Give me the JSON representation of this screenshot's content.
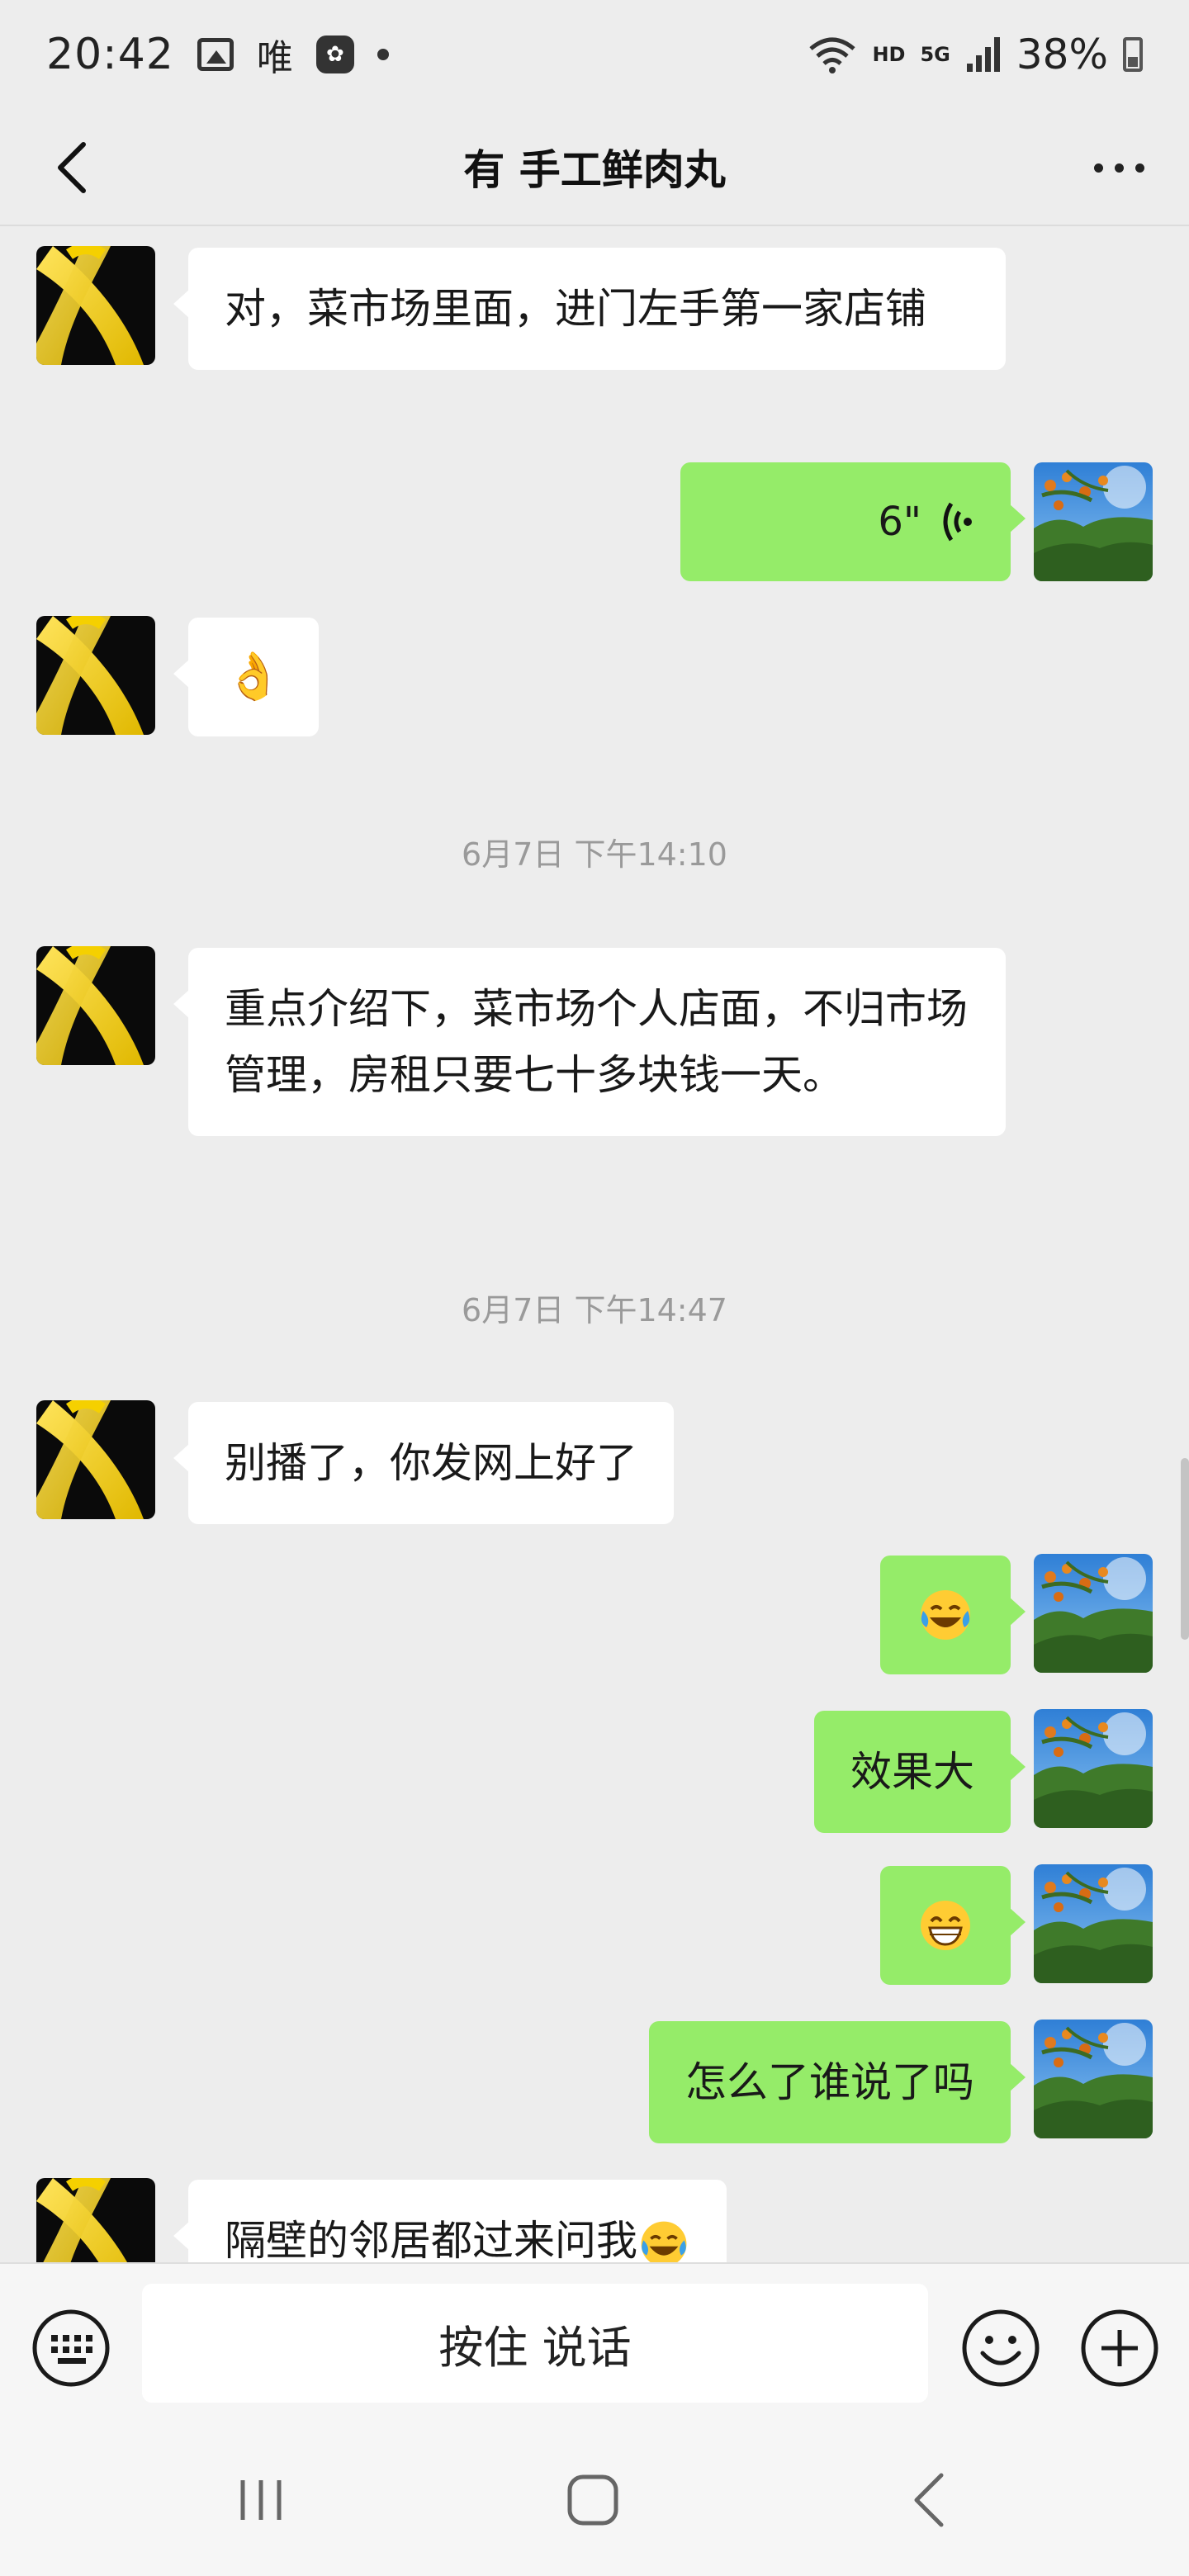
{
  "status_bar": {
    "time": "20:42",
    "app_char": "唯",
    "hd_label": "HD",
    "network_label": "5G",
    "battery": "38%"
  },
  "header": {
    "title": "有 手工鲜肉丸"
  },
  "messages": [
    {
      "side": "in",
      "type": "text",
      "text": "对，菜市场里面，进门左手第一家店铺"
    },
    {
      "side": "out",
      "type": "voice",
      "duration": "6\""
    },
    {
      "side": "in",
      "type": "emoji",
      "emoji": "👌"
    },
    {
      "type": "time",
      "text": "6月7日 下午14:10"
    },
    {
      "side": "in",
      "type": "text",
      "text": "重点介绍下，菜市场个人店面，不归市场管理，房租只要七十多块钱一天。"
    },
    {
      "type": "time",
      "text": "6月7日 下午14:47"
    },
    {
      "side": "in",
      "type": "text",
      "text": "别播了，你发网上好了"
    },
    {
      "side": "out",
      "type": "emoji",
      "emoji": "laughing-tears"
    },
    {
      "side": "out",
      "type": "text",
      "text": "效果大"
    },
    {
      "side": "out",
      "type": "emoji",
      "emoji": "grin"
    },
    {
      "side": "out",
      "type": "text",
      "text": "怎么了谁说了吗"
    },
    {
      "side": "in",
      "type": "text",
      "text": "隔壁的邻居都过来问我"
    }
  ],
  "input_bar": {
    "talk_label": "按住 说话"
  },
  "colors": {
    "background": "#ededed",
    "bubble_in": "#ffffff",
    "bubble_out": "#95ec69"
  },
  "icons": {
    "back": "back-arrow-icon",
    "more": "more-dots-icon",
    "keyboard": "keyboard-icon",
    "emoji": "smiley-icon",
    "plus": "plus-icon",
    "voice": "voice-wave-icon"
  }
}
